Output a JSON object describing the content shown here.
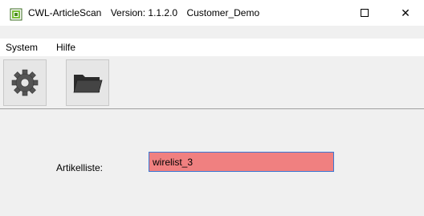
{
  "window": {
    "app_name": "CWL-ArticleScan",
    "version": "Version: 1.1.2.0",
    "customer": "Customer_Demo",
    "maximize_icon": "maximize-icon",
    "close_glyph": "✕"
  },
  "menu": {
    "items": [
      {
        "label": "System"
      },
      {
        "label": "Hilfe"
      }
    ]
  },
  "toolbar": {
    "buttons": [
      {
        "icon": "gear-icon"
      },
      {
        "icon": "folder-icon"
      }
    ]
  },
  "form": {
    "article_list_label": "Artikelliste:",
    "article_list_value": "wirelist_3",
    "input_bg_color": "#f08080",
    "input_border_color": "#3a78d4"
  }
}
